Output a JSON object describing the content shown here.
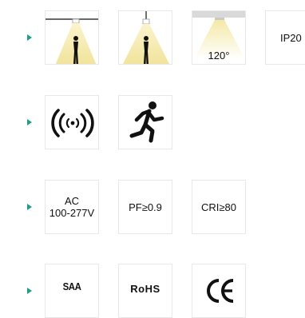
{
  "rows": [
    {
      "tiles": [
        {
          "name": "ceiling-light-beam-icon"
        },
        {
          "name": "pendant-light-beam-icon"
        },
        {
          "name": "beam-angle-icon",
          "label": "120°"
        },
        {
          "name": "ip-rating",
          "label": "IP20"
        }
      ]
    },
    {
      "tiles": [
        {
          "name": "wireless-signal-icon"
        },
        {
          "name": "running-person-icon"
        }
      ]
    },
    {
      "tiles": [
        {
          "name": "voltage-label",
          "line1": "AC",
          "line2": "100-277V"
        },
        {
          "name": "power-factor-label",
          "label": "PF≥0.9"
        },
        {
          "name": "cri-label",
          "label": "CRI≥80"
        }
      ]
    },
    {
      "tiles": [
        {
          "name": "saa-logo",
          "label": "SAA"
        },
        {
          "name": "rohs-logo",
          "label": "RoHS"
        },
        {
          "name": "ce-mark-icon"
        }
      ]
    }
  ],
  "colors": {
    "bullet": "#1a9e8e",
    "beam": "#f3e7a6",
    "border": "#e8e8e8"
  }
}
